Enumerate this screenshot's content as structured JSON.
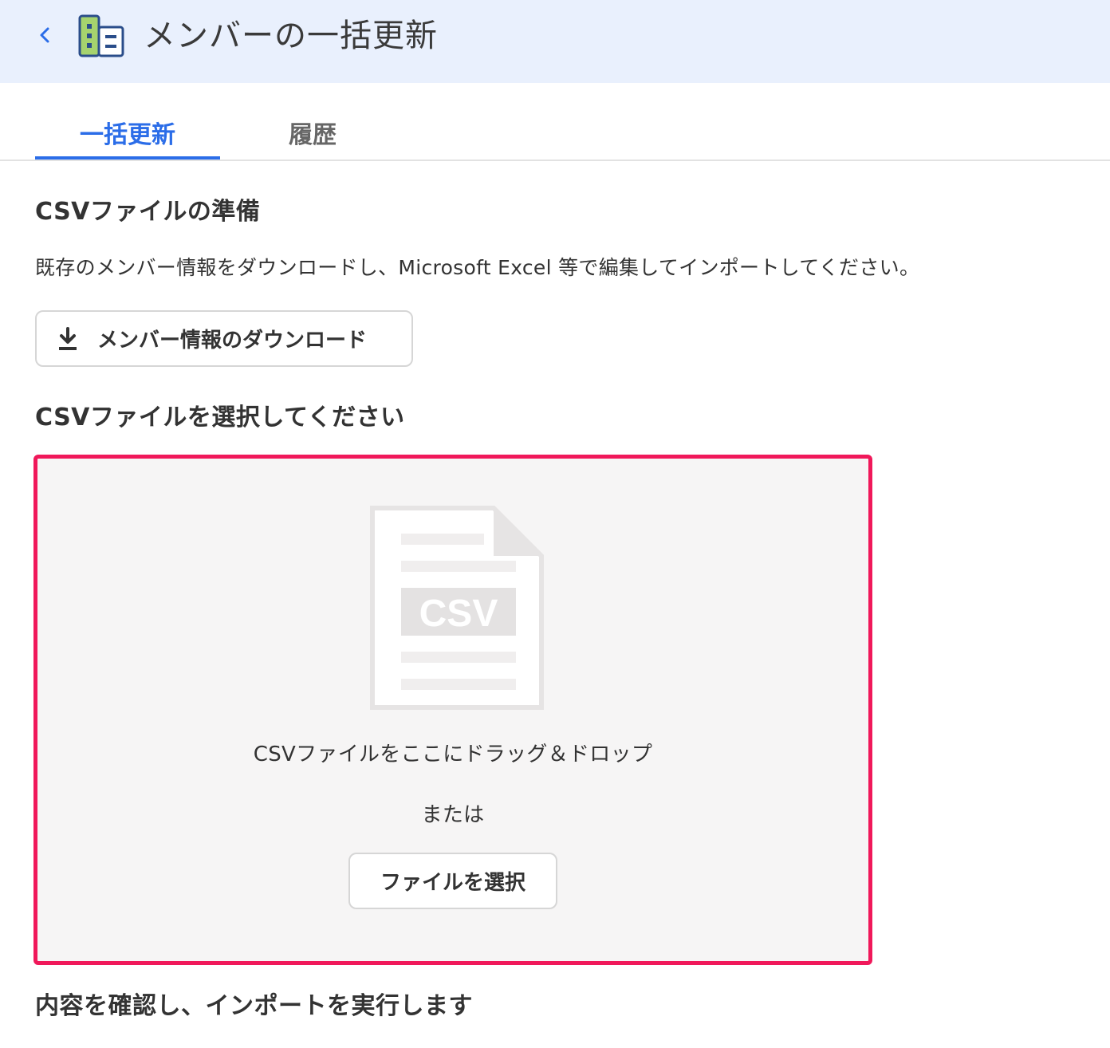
{
  "header": {
    "title": "メンバーの一括更新",
    "back_icon": "chevron-left-icon",
    "app_icon": "building-icon"
  },
  "tabs": [
    {
      "label": "一括更新",
      "active": true
    },
    {
      "label": "履歴",
      "active": false
    }
  ],
  "prepare": {
    "title": "CSVファイルの準備",
    "description": "既存のメンバー情報をダウンロードし、Microsoft Excel 等で編集してインポートしてください。",
    "download_button": "メンバー情報のダウンロード",
    "download_icon": "download-icon"
  },
  "select": {
    "title": "CSVファイルを選択してください",
    "illustration_label": "CSV",
    "drop_text": "CSVファイルをここにドラッグ＆ドロップ",
    "or_text": "または",
    "select_button": "ファイルを選択"
  },
  "confirm": {
    "title": "内容を確認し、インポートを実行します"
  },
  "colors": {
    "accent": "#2b6de8",
    "header_bg": "#e9f0fd",
    "highlight_border": "#f0185a",
    "dropzone_bg": "#f6f5f5"
  }
}
